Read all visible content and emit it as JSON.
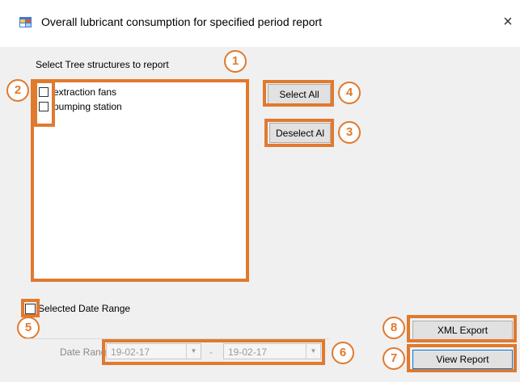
{
  "window": {
    "title": "Overall lubricant consumption for specified period report",
    "close_icon": "close-icon",
    "close_glyph": "×"
  },
  "tree": {
    "label": "Select Tree structures to report",
    "items": [
      {
        "label": "extraction fans",
        "checked": false
      },
      {
        "label": "pumping station",
        "checked": false
      }
    ]
  },
  "buttons": {
    "select_all": "Select All",
    "deselect_all": "Deselect Al",
    "xml_export": "XML Export",
    "view_report": "View Report"
  },
  "date": {
    "checkbox_label": "Selected Date Range",
    "range_label": "Date Range",
    "from_value": "19-02-17",
    "to_value": "19-02-17",
    "separator": "-",
    "arrow_glyph": "▼"
  },
  "annotations": {
    "n1": "1",
    "n2": "2",
    "n3": "3",
    "n4": "4",
    "n5": "5",
    "n6": "6",
    "n7": "7",
    "n8": "8"
  },
  "colors": {
    "highlight": "#e07a2e",
    "window_bg": "#f0f0f0",
    "button_bg": "#e1e1e1"
  }
}
